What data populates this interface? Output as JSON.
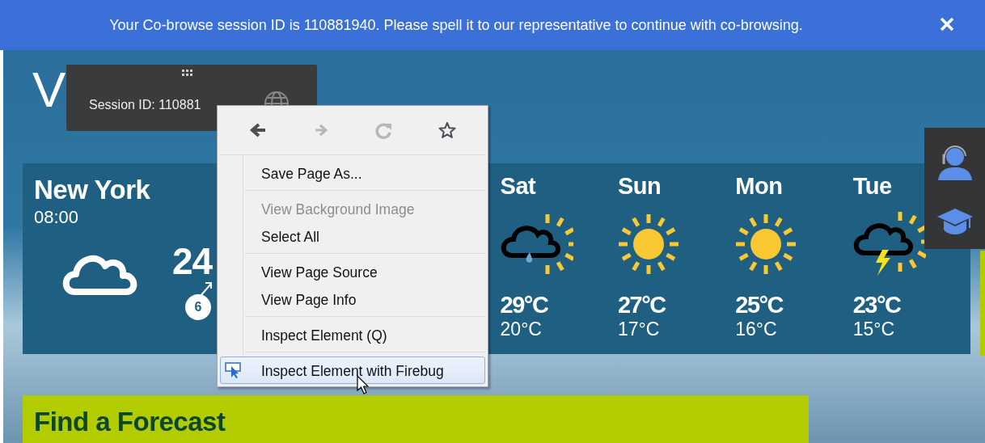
{
  "banner": {
    "message": "Your Co-browse session ID is 110881940. Please spell it to our representative to continue with co-browsing."
  },
  "site": {
    "logo": "V"
  },
  "session_widget": {
    "label": "Session ID: 110881"
  },
  "current": {
    "city": "New York",
    "time": "08:00",
    "temperature": "24",
    "wind_speed": "6"
  },
  "forecast": [
    {
      "day": "Sat",
      "kind": "rain-sun",
      "high": "29°C",
      "low": "20°C"
    },
    {
      "day": "Sun",
      "kind": "sun",
      "high": "27°C",
      "low": "17°C"
    },
    {
      "day": "Mon",
      "kind": "sun",
      "high": "25°C",
      "low": "16°C"
    },
    {
      "day": "Tue",
      "kind": "storm-sun",
      "high": "23°C",
      "low": "15°C"
    }
  ],
  "find_forecast": {
    "title": "Find a Forecast"
  },
  "context_menu": {
    "nav": [
      {
        "kind": "back",
        "disabled": false
      },
      {
        "kind": "forward",
        "disabled": true
      },
      {
        "kind": "reload",
        "disabled": true
      },
      {
        "kind": "bookmark",
        "disabled": false
      }
    ],
    "items": [
      {
        "kind": "item",
        "label": "Save Page As...",
        "disabled": false,
        "selected": false
      },
      {
        "kind": "separator"
      },
      {
        "kind": "item",
        "label": "View Background Image",
        "disabled": true,
        "selected": false
      },
      {
        "kind": "item",
        "label": "Select All",
        "disabled": false,
        "selected": false
      },
      {
        "kind": "separator"
      },
      {
        "kind": "item",
        "label": "View Page Source",
        "disabled": false,
        "selected": false
      },
      {
        "kind": "item",
        "label": "View Page Info",
        "disabled": false,
        "selected": false
      },
      {
        "kind": "separator"
      },
      {
        "kind": "item",
        "label": "Inspect Element (Q)",
        "disabled": false,
        "selected": false
      },
      {
        "kind": "separator"
      },
      {
        "kind": "tool",
        "label": "Inspect Element with Firebug",
        "disabled": false,
        "selected": true
      }
    ]
  }
}
